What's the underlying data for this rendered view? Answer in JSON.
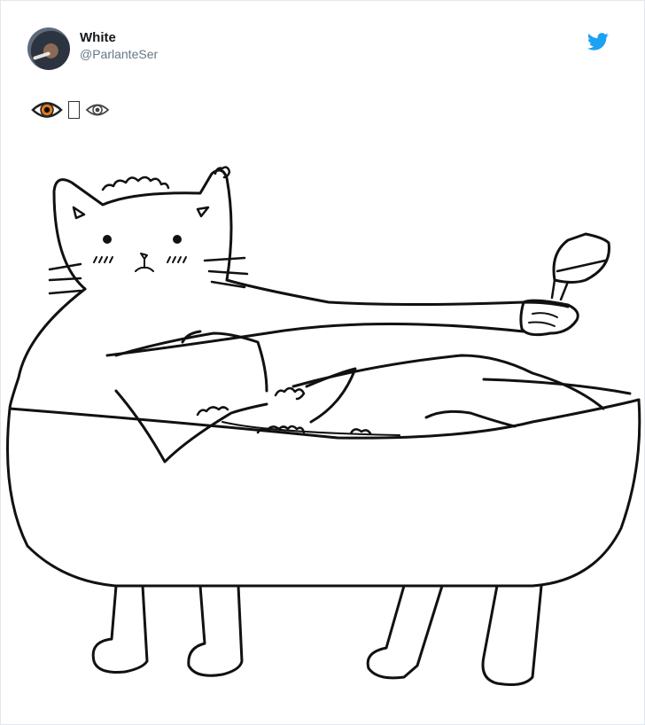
{
  "author": {
    "name": "White",
    "handle": "@ParlanteSer",
    "avatar_icon": "profile-photo"
  },
  "brand": {
    "icon": "twitter-bird-icon",
    "color": "#1da1f2"
  },
  "tweet": {
    "emojis": [
      "eye-emoji",
      "missing-glyph",
      "eye-emoji"
    ]
  },
  "media": {
    "subject": "cat-in-bathtub-drawing"
  }
}
